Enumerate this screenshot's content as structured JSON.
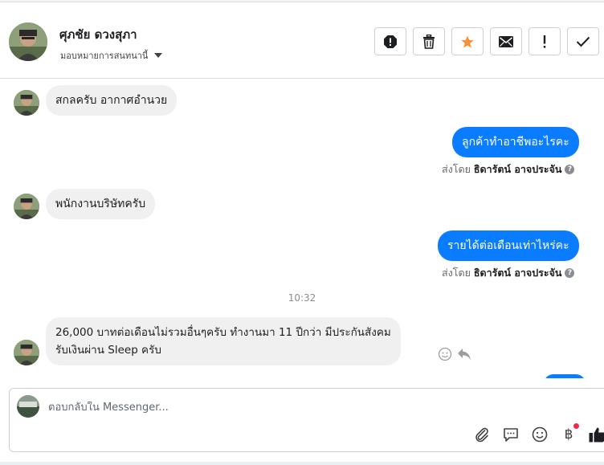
{
  "header": {
    "contact_name": "ศุภชัย ดวงสุภา",
    "assign_label": "มอบหมายการสนทนานี้",
    "actions": [
      {
        "name": "spam-button",
        "icon": "alert-octagon-icon"
      },
      {
        "name": "delete-button",
        "icon": "trash-icon"
      },
      {
        "name": "star-button",
        "icon": "star-icon",
        "color": "#f7923b"
      },
      {
        "name": "mark-unread-button",
        "icon": "envelope-icon"
      },
      {
        "name": "follow-up-button",
        "icon": "exclamation-icon"
      },
      {
        "name": "mark-done-button",
        "icon": "checkmark-icon"
      }
    ]
  },
  "messages": [
    {
      "direction": "in",
      "text": "สกลครับ อากาศอำนวย"
    },
    {
      "direction": "out",
      "text": "ลูกค้าทำอาชีพอะไรคะ",
      "sent_by_prefix": "ส่งโดย",
      "sent_by_name": "ธิดารัตน์ อาจประจัน"
    },
    {
      "direction": "in",
      "text": "พนักงานบริษัทครับ"
    },
    {
      "direction": "out",
      "text": "รายได้ต่อเดือนเท่าไหร่คะ",
      "sent_by_prefix": "ส่งโดย",
      "sent_by_name": "ธิดารัตน์ อาจประจัน"
    },
    {
      "direction": "in",
      "text_line1": "26,000 บาทต่อเดือนไม่รวมอื่นๆครับ ทำงานมา 11 ปีกว่า มีประกันสังคม",
      "text_line2": "รับเงินผ่าน Sleep ครับ"
    }
  ],
  "timestamp": "10:32",
  "composer": {
    "placeholder": "ตอบกลับใน Messenger...",
    "tools": [
      "paperclip-icon",
      "saved-reply-icon",
      "emoji-icon",
      "baht-payment-icon",
      "thumbs-up-icon"
    ],
    "baht_symbol": "฿"
  },
  "colors": {
    "outgoing_bubble": "#0a7cff",
    "incoming_bubble": "#f0f0f0",
    "star": "#f7923b",
    "notification_dot": "#f02849"
  }
}
